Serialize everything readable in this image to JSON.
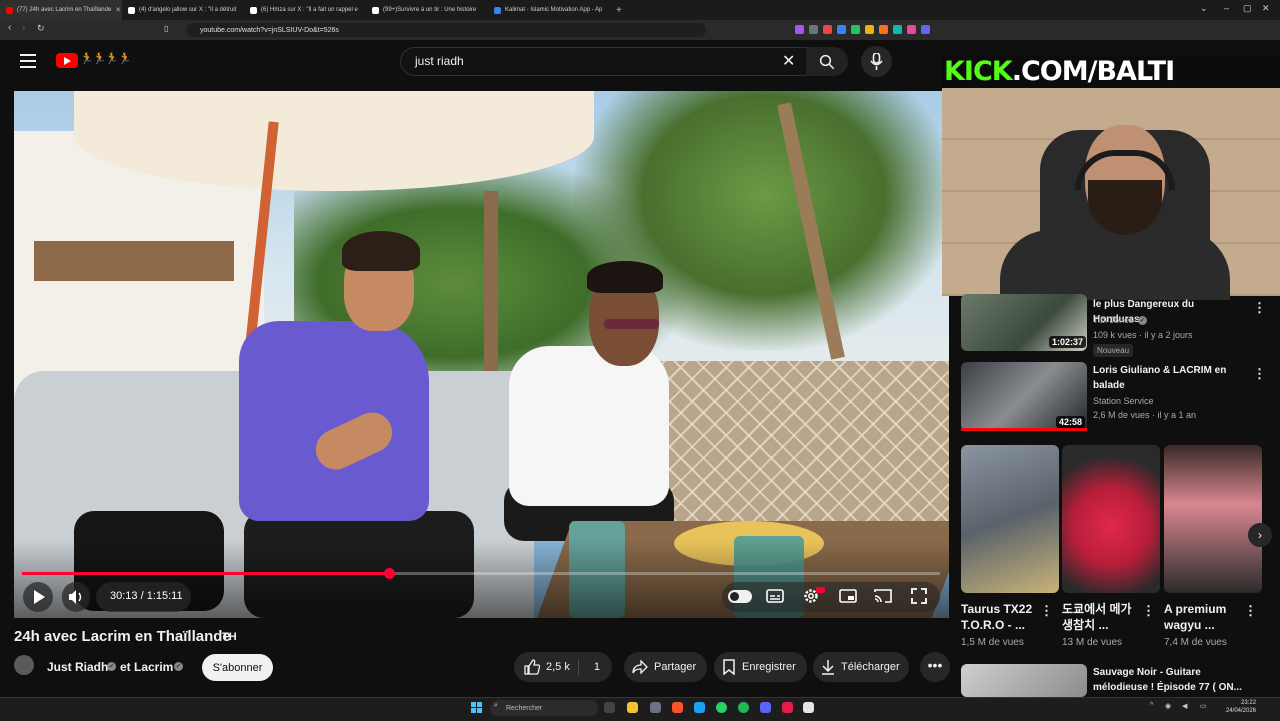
{
  "browser": {
    "tabs": [
      {
        "label": "(77) 24h avec Lacrim en Thaïllande",
        "active": true,
        "favicon_color": "#ff0000"
      },
      {
        "label": "(4) d'angelo jallow sur X : \"Il a détruit",
        "active": false,
        "favicon_color": "#ffffff"
      },
      {
        "label": "(6) Hmza sur X : \"Il a fait un rappel e",
        "active": false,
        "favicon_color": "#ffffff"
      },
      {
        "label": "(99+)Survivre à un tir : Une histoire",
        "active": false,
        "favicon_color": "#ffffff"
      },
      {
        "label": "Kalimat - Islamic Motivation App - Ap",
        "active": false,
        "favicon_color": "#3b82f6"
      }
    ],
    "url": "youtube.com/watch?v=jnSLSIUV-Do&t=526s"
  },
  "header": {
    "search_value": "just riadh",
    "logo_doodle": "🏃🏃🏃🏃"
  },
  "player": {
    "current_time": "30:13",
    "duration": "1:15:11",
    "time_display": "30:13 / 1:15:11",
    "progress": 0.4
  },
  "video": {
    "title": "24h avec Lacrim en Thaïllande",
    "title_tag": "TH",
    "channel": "Just Riadh",
    "collab": "et Lacrim",
    "subscribe_label": "S'abonner",
    "likes": "2,5 k",
    "dislikes": "1",
    "share_label": "Partager",
    "save_label": "Enregistrer",
    "download_label": "Télécharger",
    "more": "•••"
  },
  "overlay": {
    "kick_brand": "KICK",
    "kick_rest": ".COM/BALTI"
  },
  "sidebar": {
    "recs": [
      {
        "title": "le plus Dangereux du Honduras",
        "channel": "Tibi Jones",
        "meta": "109 k vues · il y a 2 jours",
        "badge": "Nouveau",
        "duration": "1:02:37"
      },
      {
        "title": "Loris Giuliano & LACRIM en balade",
        "channel": "Station Service",
        "meta": "2,6 M de vues · il y a 1 an",
        "duration": "42:58"
      },
      {
        "title": "Sauvage Noir - Guitare mélodieuse ! Épisode 77 ( ON...",
        "channel": "",
        "meta": ""
      }
    ],
    "shorts": [
      {
        "title": "Taurus TX22 T.O.R.O - ...",
        "views": "1,5 M de vues"
      },
      {
        "title": "도쿄에서 메가 생참치 ...",
        "views": "13 M de vues"
      },
      {
        "title": "A premium wagyu ...",
        "views": "7,4 M de vues"
      }
    ]
  },
  "taskbar": {
    "search_placeholder": "Rechercher",
    "time": "23:22",
    "date": "24/04/2026"
  }
}
